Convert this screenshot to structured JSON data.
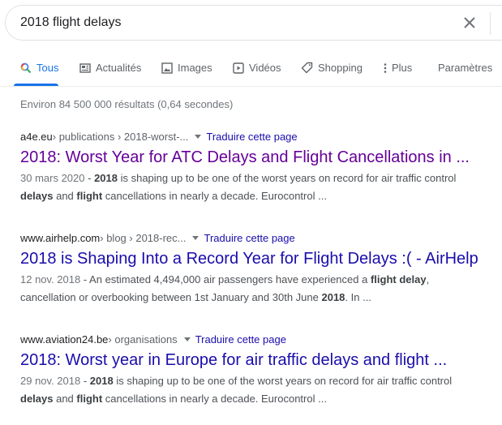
{
  "search": {
    "query": "2018 flight delays"
  },
  "tabs": [
    {
      "label": "Tous",
      "icon": "search-icon",
      "active": true
    },
    {
      "label": "Actualités",
      "icon": "news-icon"
    },
    {
      "label": "Images",
      "icon": "image-icon"
    },
    {
      "label": "Vidéos",
      "icon": "video-icon"
    },
    {
      "label": "Shopping",
      "icon": "tag-icon"
    },
    {
      "label": "Plus",
      "icon": "more-vert-icon"
    },
    {
      "label": "Paramètres"
    }
  ],
  "stats": "Environ 84 500 000 résultats (0,64 secondes)",
  "results": [
    {
      "domain": "a4e.eu",
      "path": " › publications › 2018-worst-...",
      "translate": "Traduire cette page",
      "title": "2018: Worst Year for ATC Delays and Flight Cancellations in ...",
      "visited": true,
      "date": "30 mars 2020",
      "line1_parts": [
        " - ",
        "2018",
        " is shaping up to be one of the worst years on record for air traffic control"
      ],
      "line2_parts": [
        "delays",
        " and ",
        "flight",
        " cancellations in nearly a decade. Eurocontrol ..."
      ]
    },
    {
      "domain": "www.airhelp.com",
      "path": " › blog › 2018-rec...",
      "translate": "Traduire cette page",
      "title": "2018 is Shaping Into a Record Year for Flight Delays :( - AirHelp",
      "visited": false,
      "date": "12 nov. 2018",
      "line1_parts": [
        " - An estimated 4,494,000 air passengers have experienced a ",
        "flight delay",
        ","
      ],
      "line2_parts": [
        "cancellation or overbooking between 1st January and 30th June ",
        "2018",
        ". In ..."
      ]
    },
    {
      "domain": "www.aviation24.be",
      "path": " › organisations",
      "translate": "Traduire cette page",
      "title": "2018: Worst year in Europe for air traffic delays and flight ...",
      "visited": false,
      "date": "29 nov. 2018",
      "line1_parts": [
        " - ",
        "2018",
        " is shaping up to be one of the worst years on record for air traffic control"
      ],
      "line2_parts": [
        "delays",
        " and ",
        "flight",
        " cancellations in nearly a decade. Eurocontrol ..."
      ]
    }
  ],
  "colors": {
    "link": "#1a0dab",
    "visited": "#660099",
    "accent": "#1a73e8"
  }
}
